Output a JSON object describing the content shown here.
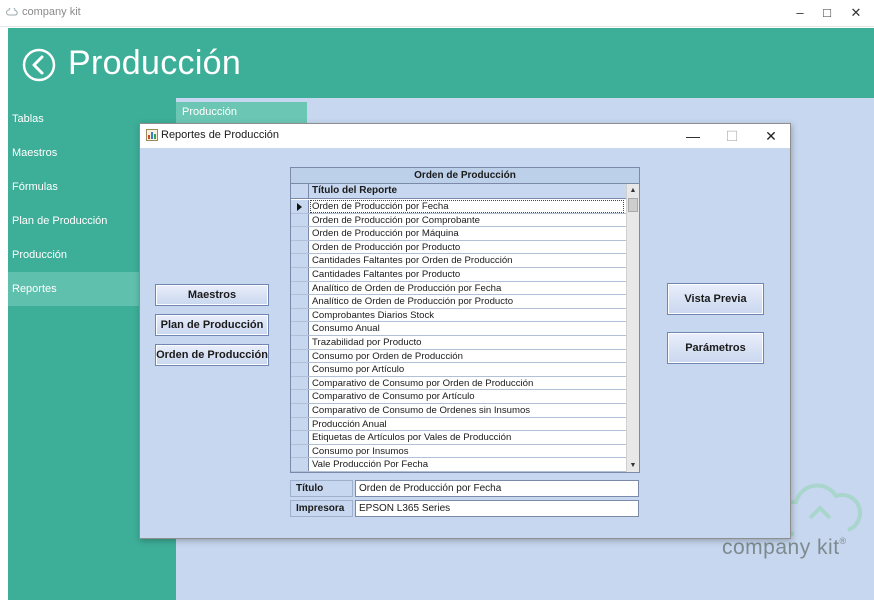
{
  "window": {
    "title": "company kit",
    "minimize": "–",
    "maximize": "□",
    "close": "✕"
  },
  "header": {
    "title": "Producción",
    "back_icon": "back-arrow-circle-icon"
  },
  "sidebar": {
    "items": [
      {
        "label": "Tablas",
        "active": false
      },
      {
        "label": "Maestros",
        "active": false
      },
      {
        "label": "Fórmulas",
        "active": false
      },
      {
        "label": "Plan de Producción",
        "active": false
      },
      {
        "label": "Producción",
        "active": false
      },
      {
        "label": "Reportes",
        "active": true
      }
    ]
  },
  "content_tab": {
    "label": "Producción"
  },
  "watermark": {
    "text": "company kit",
    "registered": "®"
  },
  "dialog": {
    "title": "Reportes de Producción",
    "minimize": "—",
    "maximize": "☐",
    "close": "✕",
    "left_buttons": [
      "Maestros",
      "Plan de Producción",
      "Orden de Producción"
    ],
    "right_buttons": [
      "Vista Previa",
      "Parámetros"
    ],
    "grid": {
      "caption": "Orden de Producción",
      "column_header": "Título del Reporte",
      "current_row": 0,
      "rows": [
        "Orden de Producción por Fecha",
        "Orden de Producción por Comprobante",
        "Orden de Producción por Máquina",
        "Orden de Producción por Producto",
        "Cantidades Faltantes por Orden de Producción",
        "Cantidades Faltantes por Producto",
        "Analítico de Orden de Producción por Fecha",
        "Analítico de Orden de Producción por Producto",
        "Comprobantes Diarios Stock",
        "Consumo Anual",
        "Trazabilidad por Producto",
        "Consumo por Orden de Producción",
        "Consumo por Artículo",
        "Comparativo de Consumo por Orden de Producción",
        "Comparativo de Consumo por Artículo",
        "Comparativo de Consumo de Ordenes sin Insumos",
        "Producción Anual",
        "Etiquetas de Artículos por Vales de Producción",
        "Consumo por Insumos",
        "Vale Producción Por Fecha"
      ]
    },
    "fields": {
      "titulo_label": "Título",
      "titulo_value": "Orden de Producción por Fecha",
      "impresora_label": "Impresora",
      "impresora_value": "EPSON L365 Series"
    }
  },
  "colors": {
    "accent": "#3dae98",
    "background": "#c6d7ef"
  }
}
